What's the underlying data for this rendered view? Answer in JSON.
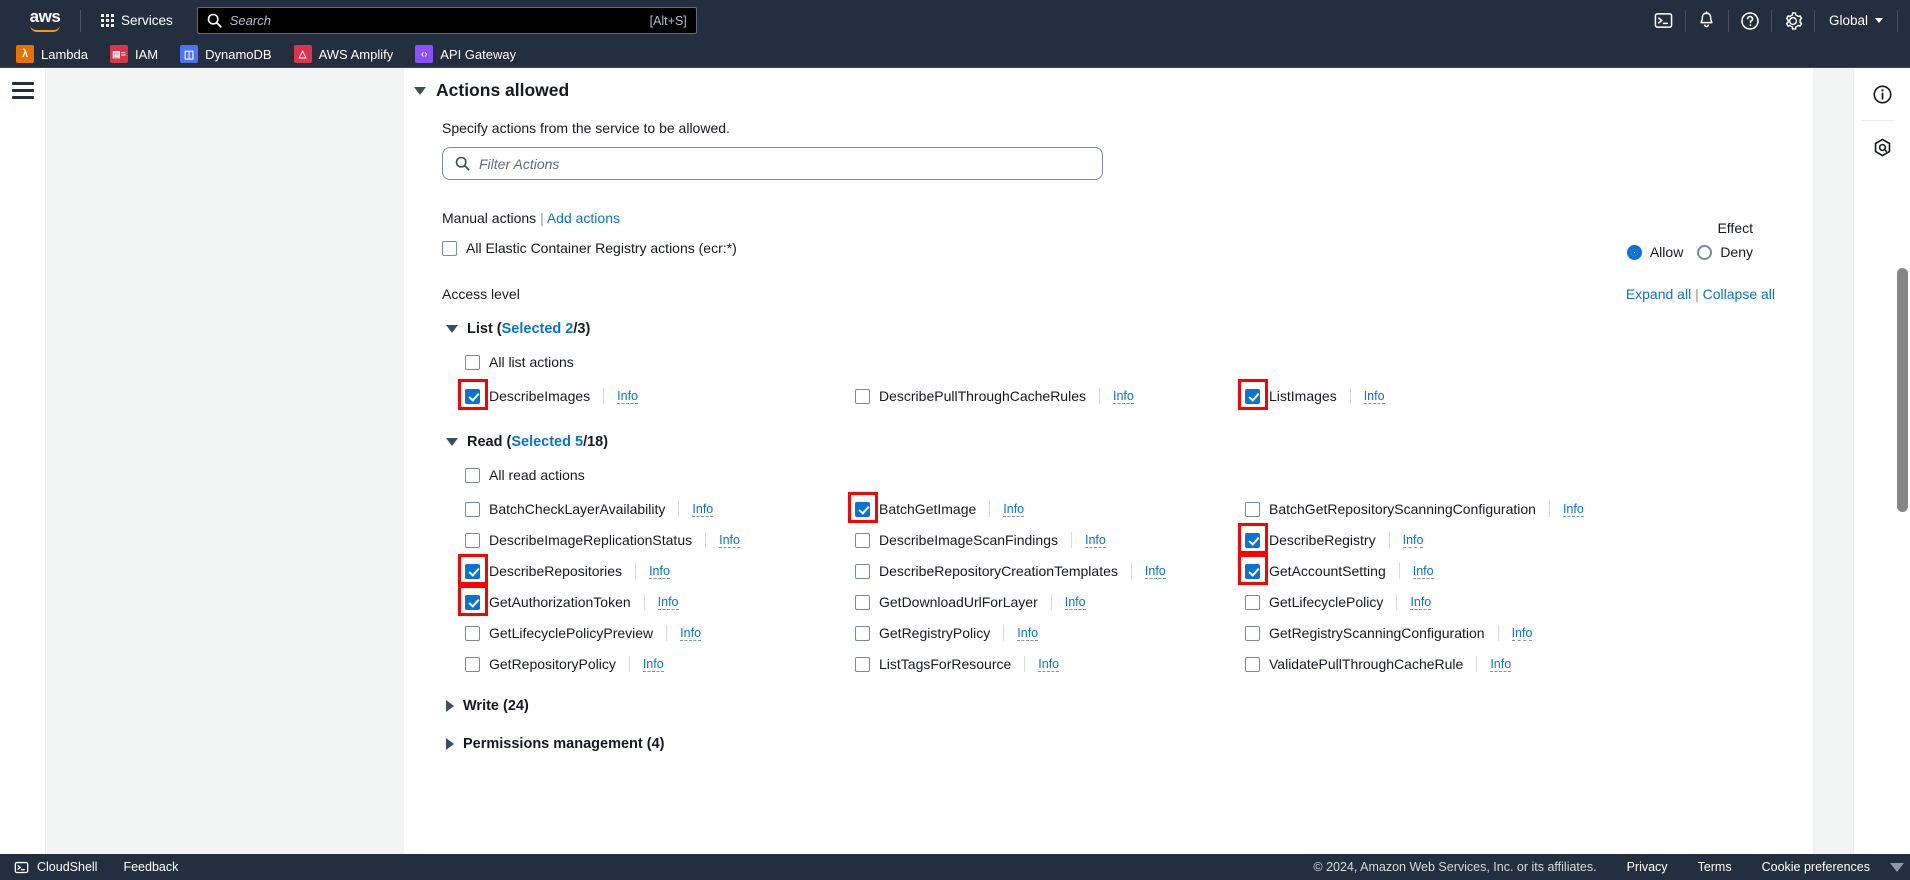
{
  "topnav": {
    "logo_text": "aws",
    "services_label": "Services",
    "search_placeholder": "Search",
    "search_shortcut": "[Alt+S]",
    "region_label": "Global",
    "icons": [
      "cloudshell-icon",
      "bell-icon",
      "help-icon",
      "settings-icon"
    ]
  },
  "favorites": [
    {
      "label": "Lambda",
      "color": "#ed7100",
      "glyph": "λ"
    },
    {
      "label": "IAM",
      "color": "#dd344c",
      "glyph": "≡"
    },
    {
      "label": "DynamoDB",
      "color": "#4d72f3",
      "glyph": "☰"
    },
    {
      "label": "AWS Amplify",
      "color": "#dd344c",
      "glyph": "△"
    },
    {
      "label": "API Gateway",
      "color": "#8c4fff",
      "glyph": "⎇"
    }
  ],
  "section": {
    "title": "Actions allowed",
    "hint": "Specify actions from the service to be allowed.",
    "filter_placeholder": "Filter Actions"
  },
  "effect": {
    "label": "Effect",
    "options": [
      {
        "label": "Allow",
        "selected": true
      },
      {
        "label": "Deny",
        "selected": false
      }
    ],
    "accent_color": "#0972d3"
  },
  "manual": {
    "label": "Manual actions",
    "separator": "|",
    "add_link": "Add actions",
    "all_service_actions_label": "All Elastic Container Registry actions (ecr:*)",
    "all_service_actions_checked": false
  },
  "access_level": {
    "label": "Access level",
    "expand_all": "Expand all",
    "separator": "|",
    "collapse_all": "Collapse all"
  },
  "groups": [
    {
      "name": "List",
      "selected_text": "Selected 2",
      "total_text": "/3",
      "expanded": true,
      "all_label": "All list actions",
      "all_checked": false,
      "actions": [
        {
          "name": "DescribeImages",
          "info": "Info",
          "checked": true,
          "highlighted": true
        },
        {
          "name": "DescribePullThroughCacheRules",
          "info": "Info",
          "checked": false,
          "highlighted": false
        },
        {
          "name": "ListImages",
          "info": "Info",
          "checked": true,
          "highlighted": true
        }
      ]
    },
    {
      "name": "Read",
      "selected_text": "Selected 5",
      "total_text": "/18",
      "expanded": true,
      "all_label": "All read actions",
      "all_checked": false,
      "actions": [
        {
          "name": "BatchCheckLayerAvailability",
          "info": "Info",
          "checked": false,
          "highlighted": false
        },
        {
          "name": "BatchGetImage",
          "info": "Info",
          "checked": true,
          "highlighted": true
        },
        {
          "name": "BatchGetRepositoryScanningConfiguration",
          "info": "Info",
          "checked": false,
          "highlighted": false
        },
        {
          "name": "DescribeImageReplicationStatus",
          "info": "Info",
          "checked": false,
          "highlighted": false
        },
        {
          "name": "DescribeImageScanFindings",
          "info": "Info",
          "checked": false,
          "highlighted": false
        },
        {
          "name": "DescribeRegistry",
          "info": "Info",
          "checked": true,
          "highlighted": true
        },
        {
          "name": "DescribeRepositories",
          "info": "Info",
          "checked": true,
          "highlighted": true
        },
        {
          "name": "DescribeRepositoryCreationTemplates",
          "info": "Info",
          "checked": false,
          "highlighted": false
        },
        {
          "name": "GetAccountSetting",
          "info": "Info",
          "checked": true,
          "highlighted": true
        },
        {
          "name": "GetAuthorizationToken",
          "info": "Info",
          "checked": true,
          "highlighted": true
        },
        {
          "name": "GetDownloadUrlForLayer",
          "info": "Info",
          "checked": false,
          "highlighted": false
        },
        {
          "name": "GetLifecyclePolicy",
          "info": "Info",
          "checked": false,
          "highlighted": false
        },
        {
          "name": "GetLifecyclePolicyPreview",
          "info": "Info",
          "checked": false,
          "highlighted": false
        },
        {
          "name": "GetRegistryPolicy",
          "info": "Info",
          "checked": false,
          "highlighted": false
        },
        {
          "name": "GetRegistryScanningConfiguration",
          "info": "Info",
          "checked": false,
          "highlighted": false
        },
        {
          "name": "GetRepositoryPolicy",
          "info": "Info",
          "checked": false,
          "highlighted": false
        },
        {
          "name": "ListTagsForResource",
          "info": "Info",
          "checked": false,
          "highlighted": false
        },
        {
          "name": "ValidatePullThroughCacheRule",
          "info": "Info",
          "checked": false,
          "highlighted": false
        }
      ]
    }
  ],
  "collapsed_groups": [
    {
      "name": "Write (24)"
    },
    {
      "name": "Permissions management (4)"
    }
  ],
  "right_rail": [
    "info-panel-icon",
    "shortcuts-icon"
  ],
  "footer": {
    "cloudshell": "CloudShell",
    "feedback": "Feedback",
    "copyright": "© 2024, Amazon Web Services, Inc. or its affiliates.",
    "links": [
      "Privacy",
      "Terms",
      "Cookie preferences"
    ]
  },
  "highlight_color": "#ff0000"
}
